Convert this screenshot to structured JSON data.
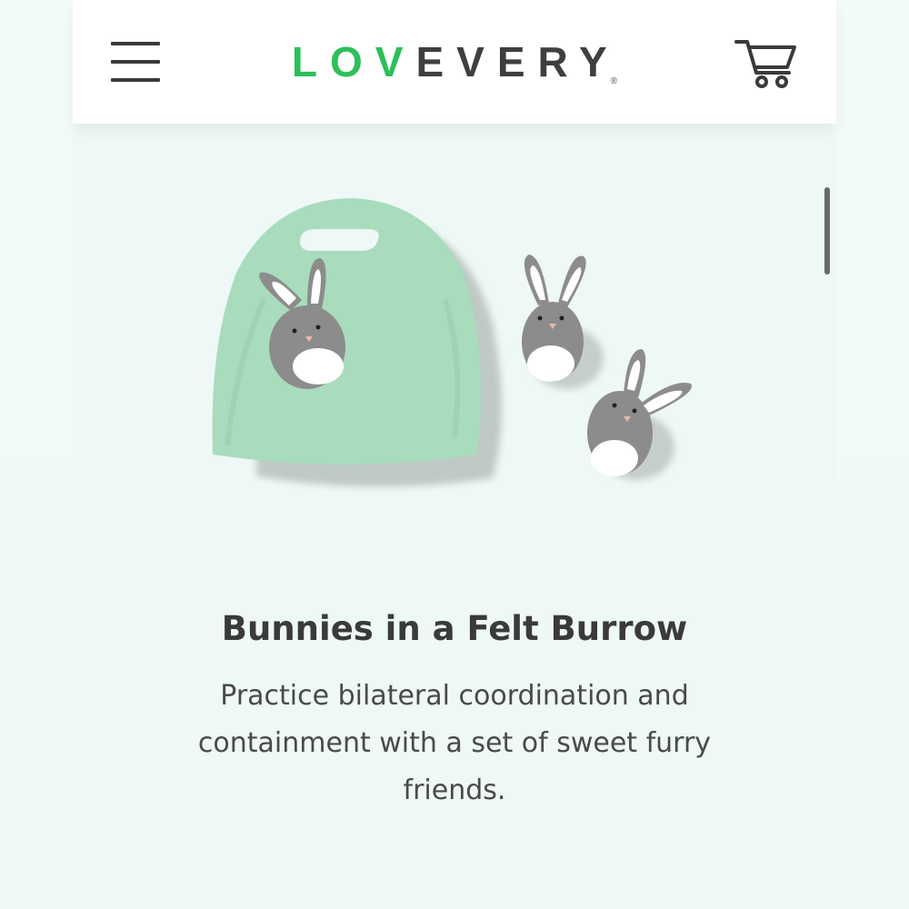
{
  "header": {
    "logo_green": "LOV",
    "logo_dark": "EVERY",
    "logo_mark": "®",
    "menu_icon": "hamburger-menu-icon",
    "cart_icon": "shopping-cart-icon"
  },
  "product": {
    "title": "Bunnies in a Felt Burrow",
    "description": "Practice bilateral coordination and containment with a set of sweet furry friends."
  },
  "colors": {
    "brand_green": "#2dbf59",
    "text_dark": "#3a3a3a",
    "background": "#eef8f6",
    "felt_green": "#a8dcbc",
    "bunny_gray": "#8c8c8c"
  }
}
